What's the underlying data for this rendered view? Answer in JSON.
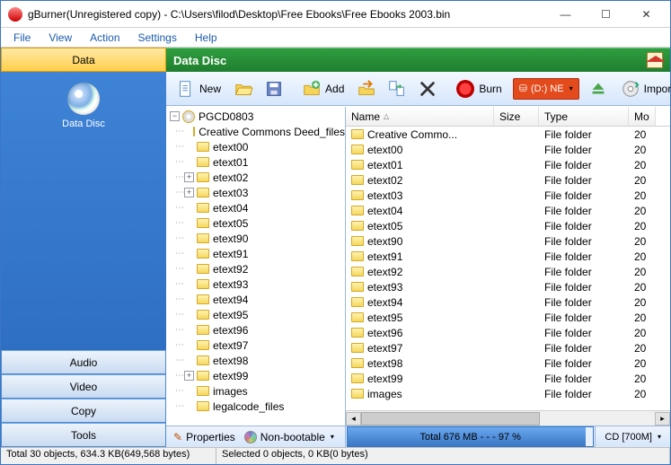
{
  "titlebar": {
    "title": "gBurner(Unregistered copy) - C:\\Users\\filod\\Desktop\\Free Ebooks\\Free Ebooks 2003.bin"
  },
  "menu": [
    "File",
    "View",
    "Action",
    "Settings",
    "Help"
  ],
  "sidepanel": {
    "active": "Data",
    "active_item_label": "Data Disc",
    "categories": [
      "Data",
      "Audio",
      "Video",
      "Copy",
      "Tools"
    ]
  },
  "greenbar": {
    "title": "Data Disc"
  },
  "toolbar": {
    "new": "New",
    "add": "Add",
    "burn": "Burn",
    "drive": "(D:) NE",
    "import": "Import"
  },
  "tree": {
    "root": "PGCD0803",
    "children": [
      {
        "label": "Creative Commons Deed_files",
        "expandable": false
      },
      {
        "label": "etext00",
        "expandable": false
      },
      {
        "label": "etext01",
        "expandable": false
      },
      {
        "label": "etext02",
        "expandable": true
      },
      {
        "label": "etext03",
        "expandable": true
      },
      {
        "label": "etext04",
        "expandable": false
      },
      {
        "label": "etext05",
        "expandable": false
      },
      {
        "label": "etext90",
        "expandable": false
      },
      {
        "label": "etext91",
        "expandable": false
      },
      {
        "label": "etext92",
        "expandable": false
      },
      {
        "label": "etext93",
        "expandable": false
      },
      {
        "label": "etext94",
        "expandable": false
      },
      {
        "label": "etext95",
        "expandable": false
      },
      {
        "label": "etext96",
        "expandable": false
      },
      {
        "label": "etext97",
        "expandable": false
      },
      {
        "label": "etext98",
        "expandable": false
      },
      {
        "label": "etext99",
        "expandable": true
      },
      {
        "label": "images",
        "expandable": false
      },
      {
        "label": "legalcode_files",
        "expandable": false
      }
    ]
  },
  "list": {
    "columns": {
      "name": "Name",
      "size": "Size",
      "type": "Type",
      "modified": "Mo"
    },
    "rows": [
      {
        "name": "Creative Commo...",
        "type": "File folder",
        "mod": "20"
      },
      {
        "name": "etext00",
        "type": "File folder",
        "mod": "20"
      },
      {
        "name": "etext01",
        "type": "File folder",
        "mod": "20"
      },
      {
        "name": "etext02",
        "type": "File folder",
        "mod": "20"
      },
      {
        "name": "etext03",
        "type": "File folder",
        "mod": "20"
      },
      {
        "name": "etext04",
        "type": "File folder",
        "mod": "20"
      },
      {
        "name": "etext05",
        "type": "File folder",
        "mod": "20"
      },
      {
        "name": "etext90",
        "type": "File folder",
        "mod": "20"
      },
      {
        "name": "etext91",
        "type": "File folder",
        "mod": "20"
      },
      {
        "name": "etext92",
        "type": "File folder",
        "mod": "20"
      },
      {
        "name": "etext93",
        "type": "File folder",
        "mod": "20"
      },
      {
        "name": "etext94",
        "type": "File folder",
        "mod": "20"
      },
      {
        "name": "etext95",
        "type": "File folder",
        "mod": "20"
      },
      {
        "name": "etext96",
        "type": "File folder",
        "mod": "20"
      },
      {
        "name": "etext97",
        "type": "File folder",
        "mod": "20"
      },
      {
        "name": "etext98",
        "type": "File folder",
        "mod": "20"
      },
      {
        "name": "etext99",
        "type": "File folder",
        "mod": "20"
      },
      {
        "name": "images",
        "type": "File folder",
        "mod": "20"
      }
    ]
  },
  "footbar": {
    "properties": "Properties",
    "bootable": "Non-bootable",
    "gauge_text": "Total   676 MB    - - -  97 %",
    "gauge_pct": 97,
    "capacity": "CD [700M]"
  },
  "status": {
    "left": "Total 30 objects, 634.3 KB(649,568 bytes)",
    "right": "Selected 0 objects, 0 KB(0 bytes)"
  }
}
